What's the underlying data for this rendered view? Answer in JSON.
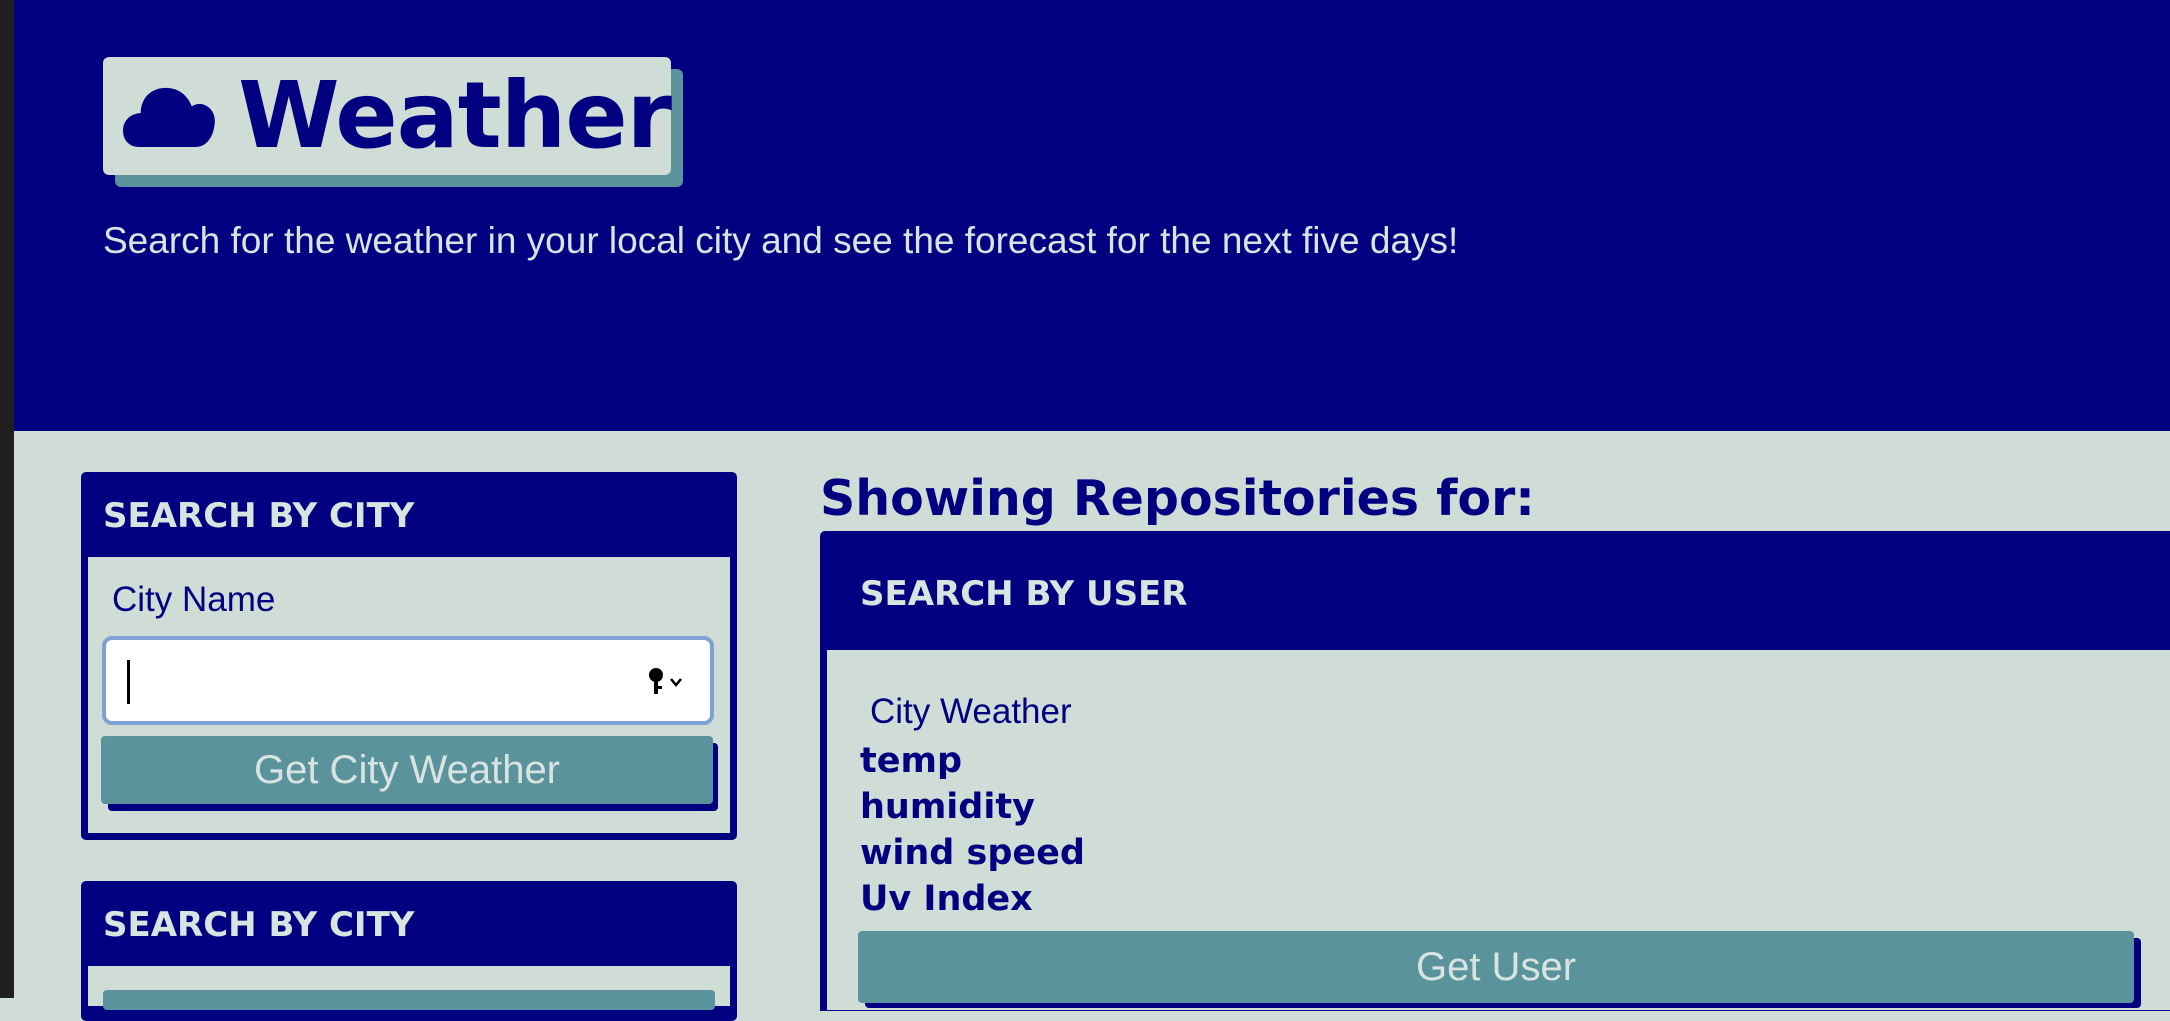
{
  "header": {
    "title": "Weather",
    "subtitle": "Search for the weather in your local city and see the forecast for the next five days!",
    "icon": "cloud-icon"
  },
  "city_card": {
    "heading": "SEARCH BY CITY",
    "field_label": "City Name",
    "input_value": "",
    "input_icon": "key-icon",
    "button_label": "Get City Weather"
  },
  "city_card_2": {
    "heading": "SEARCH BY CITY"
  },
  "repos": {
    "heading": "Showing Repositories for:",
    "card_heading": "SEARCH BY USER",
    "section_title": "City Weather",
    "items": [
      "temp",
      "humidity",
      "wind speed",
      "Uv Index"
    ],
    "button_label": "Get User"
  },
  "colors": {
    "navy": "#000080",
    "background": "#d0dcd6",
    "button": "#5a939c",
    "light_text": "#d8e4e0"
  }
}
